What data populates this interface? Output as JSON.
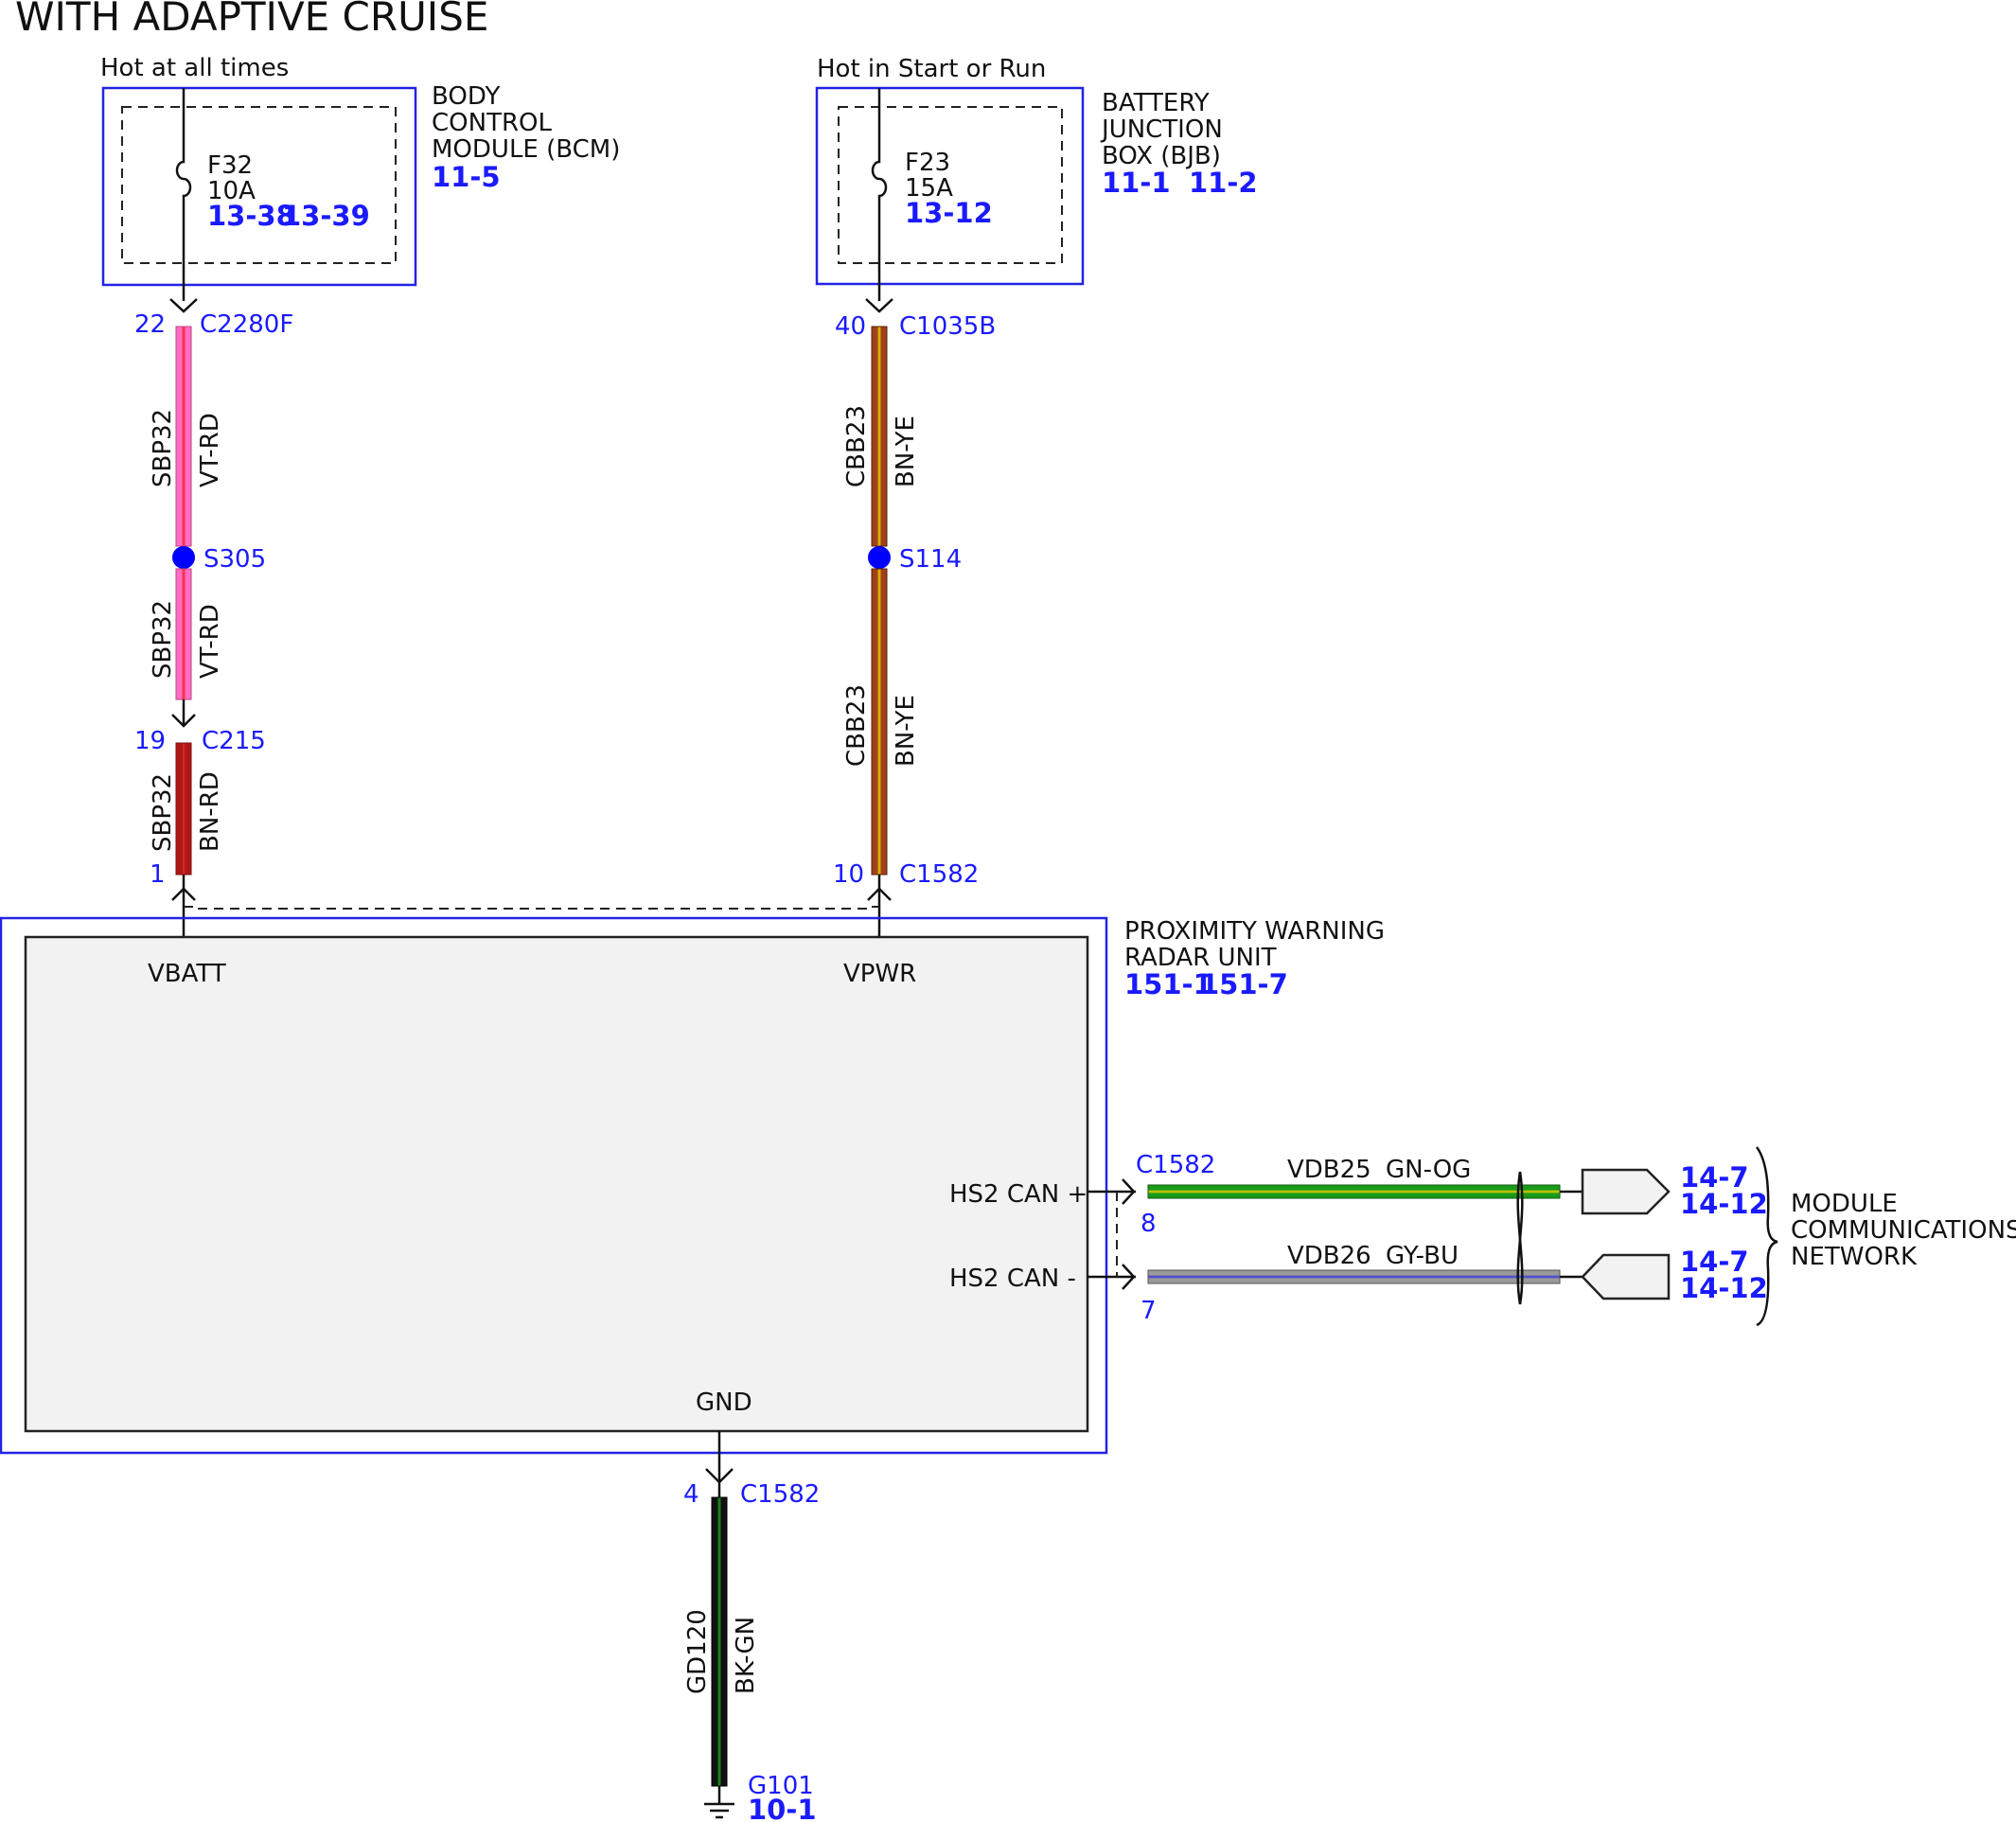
{
  "title": "WITH ADAPTIVE CRUISE",
  "bcm": {
    "supply_label": "Hot at all times",
    "name_lines": [
      "BODY",
      "CONTROL",
      "MODULE (BCM)"
    ],
    "refs": [
      "11-5"
    ],
    "fuse_name": "F32",
    "fuse_rating": "10A",
    "fuse_refs": [
      "13-38",
      "13-39"
    ]
  },
  "bjb": {
    "supply_label": "Hot in Start or Run",
    "name_lines": [
      "BATTERY",
      "JUNCTION",
      "BOX (BJB)"
    ],
    "refs": [
      "11-1",
      "11-2"
    ],
    "fuse_name": "F23",
    "fuse_rating": "15A",
    "fuse_refs": [
      "13-12"
    ]
  },
  "circuit_left": {
    "connector_top": {
      "pin": "22",
      "name": "C2280F"
    },
    "wire1": {
      "circuit": "SBP32",
      "color_code": "VT-RD",
      "colors": [
        "#ff6ec7",
        "#ff2020"
      ]
    },
    "splice": {
      "name": "S305"
    },
    "wire2": {
      "circuit": "SBP32",
      "color_code": "VT-RD",
      "colors": [
        "#ff6ec7",
        "#ff2020"
      ]
    },
    "connector_mid": {
      "pin": "19",
      "name": "C215"
    },
    "wire3": {
      "circuit": "SBP32",
      "color_code": "BN-RD",
      "colors": [
        "#b01818",
        "#e03030"
      ]
    },
    "connector_bottom": {
      "pin": "1"
    }
  },
  "circuit_right": {
    "connector_top": {
      "pin": "40",
      "name": "C1035B"
    },
    "wire1": {
      "circuit": "CBB23",
      "color_code": "BN-YE",
      "colors": [
        "#a0401a",
        "#e8c800"
      ]
    },
    "splice": {
      "name": "S114"
    },
    "wire2": {
      "circuit": "CBB23",
      "color_code": "BN-YE",
      "colors": [
        "#a0401a",
        "#e8c800"
      ]
    },
    "connector_bottom": {
      "pin": "10",
      "name": "C1582"
    }
  },
  "radar": {
    "name_lines": [
      "PROXIMITY WARNING",
      "RADAR UNIT"
    ],
    "refs": [
      "151-1",
      "151-7"
    ],
    "pin_vbatt": "VBATT",
    "pin_vpwr": "VPWR",
    "pin_can_plus": "HS2 CAN +",
    "pin_can_minus": "HS2 CAN -",
    "pin_gnd": "GND"
  },
  "can": {
    "connector": "C1582",
    "plus": {
      "pin": "8",
      "circuit": "VDB25",
      "color_code": "GN-OG",
      "colors": [
        "#1a9a1a",
        "#e8d000"
      ],
      "refs": [
        "14-7",
        "14-12"
      ]
    },
    "minus": {
      "pin": "7",
      "circuit": "VDB26",
      "color_code": "GY-BU",
      "colors": [
        "#9a9a9a",
        "#3a3ae0"
      ],
      "refs": [
        "14-7",
        "14-12"
      ]
    },
    "network_lines": [
      "MODULE",
      "COMMUNICATIONS",
      "NETWORK"
    ]
  },
  "ground": {
    "connector": {
      "pin": "4",
      "name": "C1582"
    },
    "wire": {
      "circuit": "GD120",
      "color_code": "BK-GN",
      "colors": [
        "#111111",
        "#1aa01a"
      ]
    },
    "point": {
      "name": "G101",
      "ref": "10-1"
    }
  },
  "colors": {
    "accent_blue": "#1a1aff",
    "splice": "#0000ff",
    "box_fill": "#f2f2f2"
  }
}
